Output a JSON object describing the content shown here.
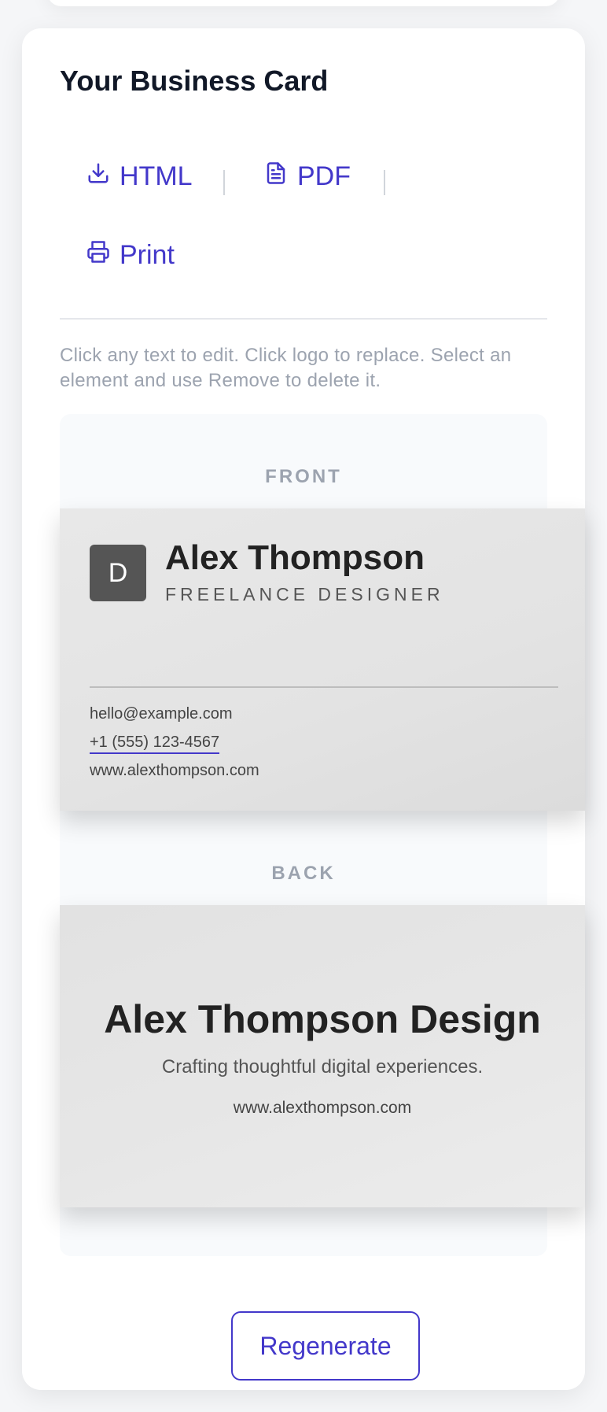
{
  "panel": {
    "title": "Your Business Card"
  },
  "actions": {
    "html_label": "HTML",
    "pdf_label": "PDF",
    "print_label": "Print"
  },
  "hint": "Click any text to edit. Click logo to replace. Select an element and use Remove to delete it.",
  "front": {
    "label": "FRONT",
    "logo_letter": "D",
    "name": "Alex Thompson",
    "role": "FREELANCE DESIGNER",
    "email": "hello@example.com",
    "phone": "+1 (555) 123-4567",
    "website": "www.alexthompson.com"
  },
  "back": {
    "label": "BACK",
    "company": "Alex Thompson Design",
    "tagline": "Crafting thoughtful digital experiences.",
    "website": "www.alexthompson.com"
  },
  "regenerate_label": "Regenerate",
  "colors": {
    "accent": "#4338ca",
    "card_text": "#222222",
    "logo_bg": "#555555"
  },
  "icons": {
    "html": "download-icon",
    "pdf": "file-text-icon",
    "print": "printer-icon"
  }
}
